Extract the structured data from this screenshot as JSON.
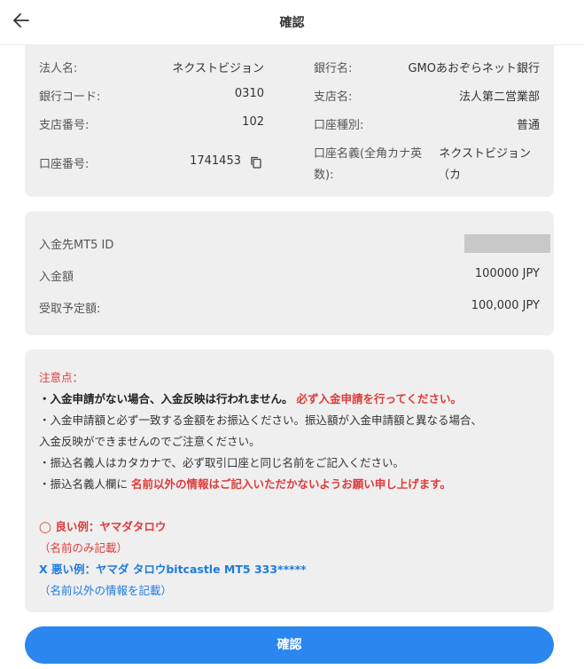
{
  "header": {
    "title": "確認",
    "back_icon": "arrow-left-icon"
  },
  "bank_info": {
    "corp_name_label": "法人名:",
    "corp_name_value": "ネクストビジョン",
    "bank_name_label": "銀行名:",
    "bank_name_value": "GMOあおぞらネット銀行",
    "bank_code_label": "銀行コード:",
    "bank_code_value": "0310",
    "branch_name_label": "支店名:",
    "branch_name_value": "法人第二営業部",
    "branch_no_label": "支店番号:",
    "branch_no_value": "102",
    "account_type_label": "口座種別:",
    "account_type_value": "普通",
    "account_no_label": "口座番号:",
    "account_no_value": "1741453",
    "account_holder_label_1": "口座名義(全角カナ英",
    "account_holder_label_2": "数):",
    "account_holder_value_1": "ネクストビジョン",
    "account_holder_value_2": "（カ"
  },
  "deposit": {
    "mt5_label": "入金先MT5 ID",
    "amount_label": "入金額",
    "amount_value": "100000 JPY",
    "receive_label": "受取予定額:",
    "receive_value": "100,000 JPY"
  },
  "notice": {
    "title": "注意点：",
    "line1_bold": "・入金申請がない場合、入金反映は行われません。",
    "line1_red": "必ず入金申請を行ってください。",
    "line2": "・入金申請額と必ず一致する金額をお振込ください。振込額が入金申請額と異なる場合、",
    "line3": "入金反映ができませんのでご注意ください。",
    "line4": "・振込名義人はカタカナで、必ず取引口座と同じ名前をご記入ください。",
    "line5_prefix": "・振込名義人欄に",
    "line5_red": "名前以外の情報はご記入いただかないようお願い申し上げます。",
    "good_example": "◯ 良い例：ヤマダタロウ",
    "good_note": "（名前のみ記載）",
    "bad_example": "X 悪い例：ヤマダ タロウbitcastle MT5 333*****",
    "bad_note": "（名前以外の情報を記載）"
  },
  "confirm_button": {
    "label": "確認"
  },
  "colors": {
    "accent": "#2b86ef",
    "card_bg": "#efefef",
    "warning_red": "#e03a3a",
    "info_blue": "#1f7ae0"
  }
}
